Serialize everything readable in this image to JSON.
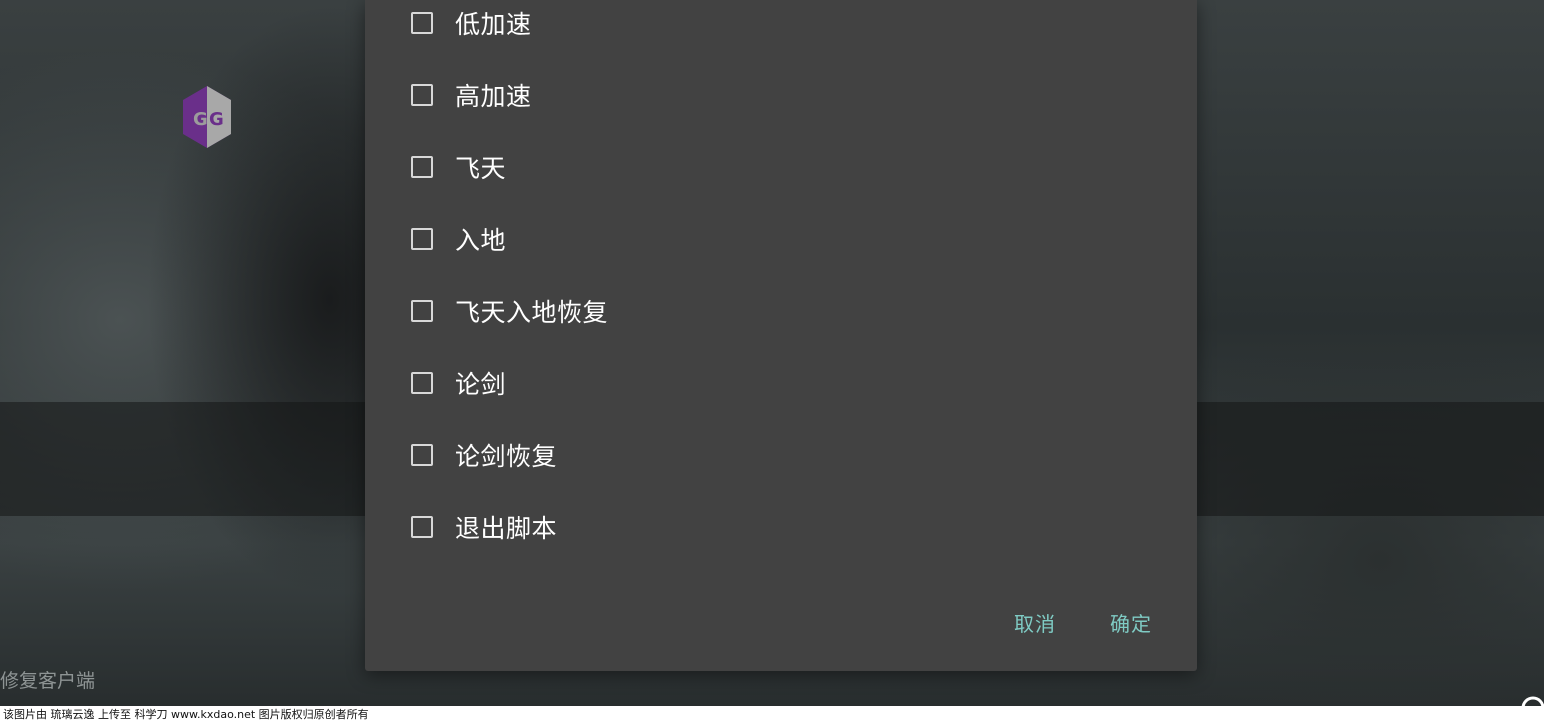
{
  "dialog": {
    "options": [
      {
        "label": "低加速",
        "checked": false
      },
      {
        "label": "高加速",
        "checked": false
      },
      {
        "label": "飞天",
        "checked": false
      },
      {
        "label": "入地",
        "checked": false
      },
      {
        "label": "飞天入地恢复",
        "checked": false
      },
      {
        "label": "论剑",
        "checked": false
      },
      {
        "label": "论剑恢复",
        "checked": false
      },
      {
        "label": "退出脚本",
        "checked": false
      }
    ],
    "cancel_label": "取消",
    "confirm_label": "确定",
    "accent_color": "#7fcbc4"
  },
  "background": {
    "side_text": "修复客户端",
    "logo_text": "GG"
  },
  "footer": {
    "text": "该图片由  琉璃云逸  上传至  科学刀  www.kxdao.net  图片版权归原创者所有"
  },
  "icons": {
    "logo": "gameguardian-logo-icon",
    "checkbox": "checkbox-unchecked-icon",
    "corner": "help-icon"
  }
}
